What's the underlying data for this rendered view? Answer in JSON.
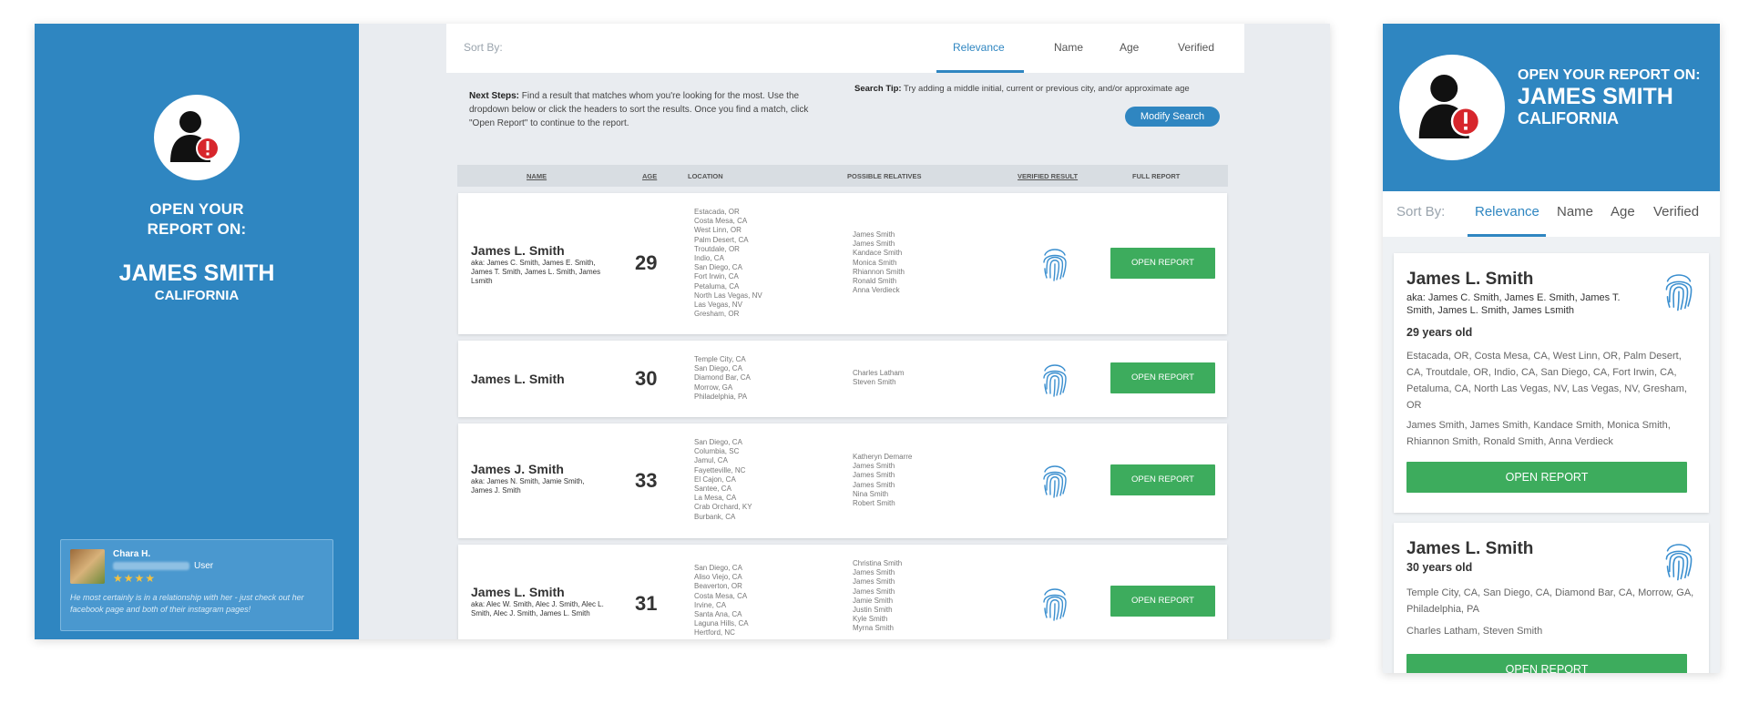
{
  "desktop": {
    "left_panel": {
      "open_line1": "OPEN YOUR",
      "open_line2": "REPORT ON:",
      "name": "JAMES SMITH",
      "state": "CALIFORNIA"
    },
    "testimonial": {
      "name": "Chara H.",
      "role": "User",
      "stars": "★★★★",
      "quote": "He most certainly is in a relationship with her - just check out her facebook page and both of their instagram pages!"
    },
    "sort": {
      "label": "Sort By:",
      "tabs": [
        "Relevance",
        "Name",
        "Age",
        "Verified"
      ],
      "active": "Relevance"
    },
    "next_steps_title": "Next Steps:",
    "next_steps_text": "Find a result that matches whom you're looking for the most. Use the dropdown below or click the headers to sort the results. Once you find a match, click \"Open Report\" to continue to the report.",
    "search_tip_title": "Search Tip:",
    "search_tip_text": "Try adding a middle initial, current or previous city, and/or approximate age",
    "modify_button": "Modify Search",
    "columns": {
      "name": "NAME",
      "age": "AGE",
      "location": "LOCATION",
      "relatives": "POSSIBLE RELATIVES",
      "verified": "VERIFIED RESULT",
      "full_report": "FULL REPORT"
    },
    "results": [
      {
        "name": "James L. Smith",
        "aka": "aka: James C. Smith, James E. Smith, James T. Smith, James L. Smith, James Lsmith",
        "age": "29",
        "locations": [
          "Estacada, OR",
          "Costa Mesa, CA",
          "West Linn, OR",
          "Palm Desert, CA",
          "Troutdale, OR",
          "Indio, CA",
          "San Diego, CA",
          "Fort Irwin, CA",
          "Petaluma, CA",
          "North Las Vegas, NV",
          "Las Vegas, NV",
          "Gresham, OR"
        ],
        "relatives": [
          "James Smith",
          "James Smith",
          "Kandace Smith",
          "Monica Smith",
          "Rhiannon Smith",
          "Ronald Smith",
          "Anna Verdieck"
        ],
        "button": "OPEN REPORT"
      },
      {
        "name": "James L. Smith",
        "aka": "",
        "age": "30",
        "locations": [
          "Temple City, CA",
          "San Diego, CA",
          "Diamond Bar, CA",
          "Morrow, GA",
          "Philadelphia, PA"
        ],
        "relatives": [
          "Charles Latham",
          "Steven Smith"
        ],
        "button": "OPEN REPORT"
      },
      {
        "name": "James J. Smith",
        "aka": "aka: James N. Smith, Jamie Smith, James J. Smith",
        "age": "33",
        "locations": [
          "San Diego, CA",
          "Columbia, SC",
          "Jamul, CA",
          "Fayetteville, NC",
          "El Cajon, CA",
          "Santee, CA",
          "La Mesa, CA",
          "Crab Orchard, KY",
          "Burbank, CA"
        ],
        "relatives": [
          "Katheryn Demarre",
          "James Smith",
          "James Smith",
          "James Smith",
          "Nina Smith",
          "Robert Smith"
        ],
        "button": "OPEN REPORT"
      },
      {
        "name": "James L. Smith",
        "aka": "aka: Alec W. Smith, Alec J. Smith, Alec L. Smith, Alec J. Smith, James L. Smith",
        "age": "31",
        "locations": [
          "San Diego, CA",
          "Aliso Viejo, CA",
          "Beaverton, OR",
          "Costa Mesa, CA",
          "Irvine, CA",
          "Santa Ana, CA",
          "Laguna Hills, CA",
          "Hertford, NC"
        ],
        "relatives": [
          "Christina Smith",
          "James Smith",
          "James Smith",
          "James Smith",
          "Jamie Smith",
          "Justin Smith",
          "Kyle Smith",
          "Myrna Smith"
        ],
        "button": "OPEN REPORT"
      }
    ]
  },
  "mobile": {
    "header": {
      "open": "OPEN YOUR REPORT ON:",
      "name": "JAMES SMITH",
      "state": "CALIFORNIA"
    },
    "sort": {
      "label": "Sort By:",
      "tabs": [
        "Relevance",
        "Name",
        "Age",
        "Verified"
      ],
      "active": "Relevance"
    },
    "results": [
      {
        "name": "James L. Smith",
        "aka": "aka: James C. Smith, James E. Smith, James T. Smith, James L. Smith, James Lsmith",
        "age": "29 years old",
        "locations": "Estacada, OR,  Costa Mesa, CA,  West Linn, OR,  Palm Desert, CA,  Troutdale, OR,  Indio, CA,  San Diego, CA,  Fort Irwin, CA,  Petaluma, CA,  North Las Vegas, NV,  Las Vegas, NV,  Gresham, OR",
        "relatives": "James Smith,  James Smith,  Kandace Smith,  Monica Smith,  Rhiannon Smith,  Ronald Smith,  Anna Verdieck",
        "button": "OPEN REPORT"
      },
      {
        "name": "James L. Smith",
        "age": "30 years old",
        "locations": "Temple City, CA,  San Diego, CA,  Diamond Bar, CA,  Morrow, GA,  Philadelphia, PA",
        "relatives": "Charles Latham,  Steven Smith",
        "button": "OPEN REPORT"
      }
    ]
  },
  "colors": {
    "brand_blue": "#2f86c1",
    "button_green": "#3dac5d",
    "fingerprint_blue": "#3b8fcf",
    "alert_red": "#d7262c"
  },
  "icons": {
    "person_alert": "person-alert-icon",
    "fingerprint": "fingerprint-icon",
    "star": "star-icon"
  }
}
